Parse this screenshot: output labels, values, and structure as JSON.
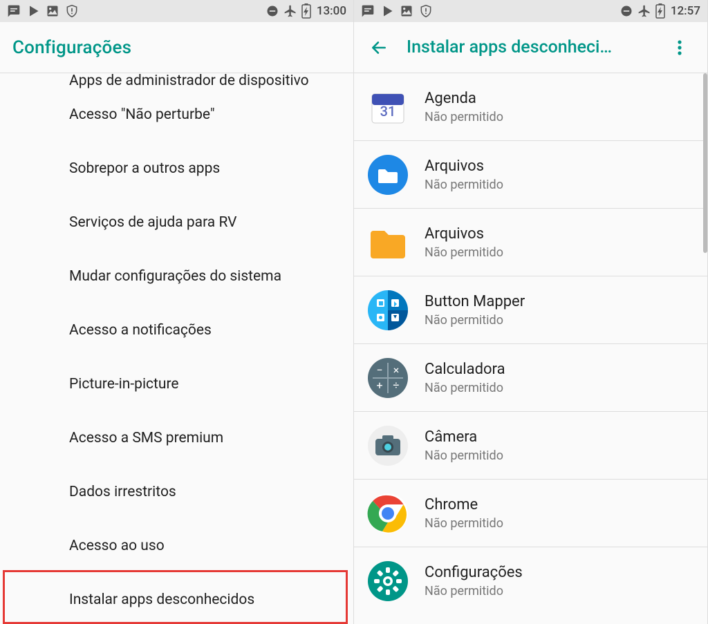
{
  "left": {
    "status_time": "13:00",
    "title": "Configurações",
    "items": [
      "Apps de administrador de dispositivo",
      "Acesso \"Não perturbe\"",
      "Sobrepor a outros apps",
      "Serviços de ajuda para RV",
      "Mudar configurações do sistema",
      "Acesso a notificações",
      "Picture-in-picture",
      "Acesso a SMS premium",
      "Dados irrestritos",
      "Acesso ao uso",
      "Instalar apps desconhecidos"
    ],
    "highlight_index": 10
  },
  "right": {
    "status_time": "12:57",
    "title": "Instalar apps desconheci…",
    "apps": [
      {
        "name": "Agenda",
        "sub": "Não permitido"
      },
      {
        "name": "Arquivos",
        "sub": "Não permitido"
      },
      {
        "name": "Arquivos",
        "sub": "Não permitido"
      },
      {
        "name": "Button Mapper",
        "sub": "Não permitido"
      },
      {
        "name": "Calculadora",
        "sub": "Não permitido"
      },
      {
        "name": "Câmera",
        "sub": "Não permitido"
      },
      {
        "name": "Chrome",
        "sub": "Não permitido"
      },
      {
        "name": "Configurações",
        "sub": "Não permitido"
      }
    ]
  },
  "status_icons": {
    "notif1": "message-icon",
    "notif2": "play-store-icon",
    "notif3": "image-icon",
    "notif4": "shield-icon",
    "dnd": "do-not-disturb-icon",
    "plane": "airplane-icon",
    "battery": "battery-charging-icon"
  }
}
